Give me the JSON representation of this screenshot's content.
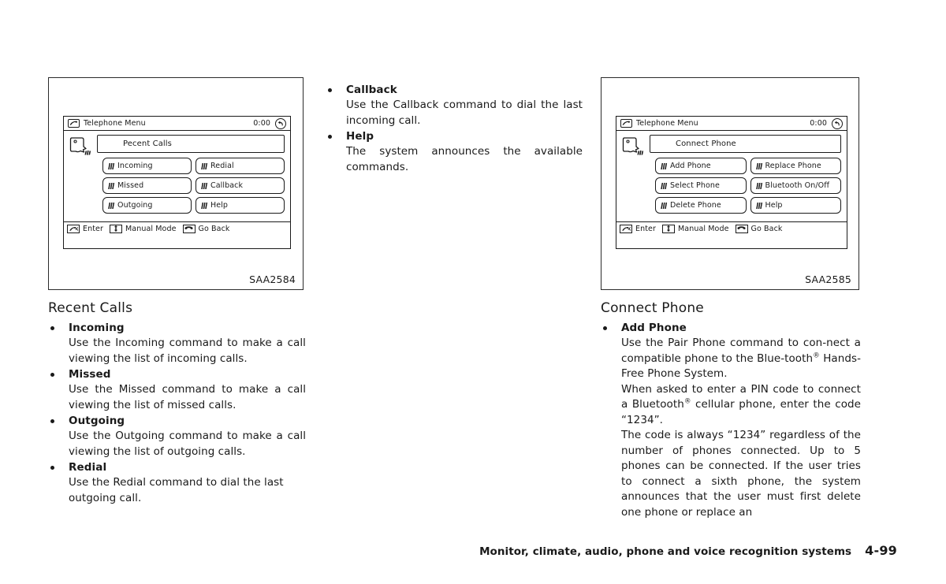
{
  "figures": [
    {
      "code": "SAA2584",
      "screen": {
        "title": "Telephone Menu",
        "clock": "0:00",
        "phone_icon": "phone-handset-icon",
        "return_icon": "return-arrow-icon",
        "head_icon": "speaking-head-icon",
        "banner_label": "Pecent Calls",
        "commands": [
          "Incoming",
          "Redial",
          "Missed",
          "Callback",
          "Outgoing",
          "Help"
        ],
        "status": [
          {
            "icon": "enter-button-icon",
            "label": "Enter"
          },
          {
            "icon": "up-down-arrows-icon",
            "label": "Manual Mode"
          },
          {
            "icon": "hang-up-phone-icon",
            "label": "Go Back"
          }
        ]
      }
    },
    {
      "code": "SAA2585",
      "screen": {
        "title": "Telephone Menu",
        "clock": "0:00",
        "phone_icon": "phone-handset-icon",
        "return_icon": "return-arrow-icon",
        "head_icon": "speaking-head-icon",
        "banner_label": "Connect Phone",
        "commands": [
          "Add Phone",
          "Replace Phone",
          "Select Phone",
          "Bluetooth On/Off",
          "Delete Phone",
          "Help"
        ],
        "status": [
          {
            "icon": "enter-button-icon",
            "label": "Enter"
          },
          {
            "icon": "up-down-arrows-icon",
            "label": "Manual Mode"
          },
          {
            "icon": "hang-up-phone-icon",
            "label": "Go Back"
          }
        ]
      }
    }
  ],
  "mid_column": {
    "items": [
      {
        "term": "Callback",
        "body": "Use the Callback command to dial the last incoming call."
      },
      {
        "term": "Help",
        "body": "The system announces the available commands."
      }
    ]
  },
  "left_section": {
    "heading": "Recent Calls",
    "items": [
      {
        "term": "Incoming",
        "body": "Use the Incoming command to make a call viewing the list of incoming calls."
      },
      {
        "term": "Missed",
        "body": "Use the Missed command to make a call viewing the list of missed calls."
      },
      {
        "term": "Outgoing",
        "body": "Use the Outgoing command to make a call viewing the list of outgoing calls."
      },
      {
        "term": "Redial",
        "body": "Use the Redial command to dial the last outgoing call."
      }
    ]
  },
  "right_section": {
    "heading": "Connect Phone",
    "term": "Add Phone",
    "paragraphs": {
      "p1_a": "Use the Pair Phone command to con-nect a compatible phone to the Blue-tooth",
      "p1_sup": "®",
      "p1_b": " Hands-Free Phone System.",
      "p2_a": "When asked to enter a PIN code to connect a Bluetooth",
      "p2_sup": "®",
      "p2_b": " cellular phone, enter the code “1234”.",
      "p3": "The code is always “1234” regardless of the number of phones connected. Up to 5 phones can be connected. If the user tries to connect a sixth phone, the system announces that the user must first delete one phone or replace an"
    }
  },
  "footer": {
    "text": "Monitor, climate, audio, phone and voice recognition systems",
    "page": "4-99"
  },
  "colors": {
    "ink": "#1a1a1a",
    "paper": "#ffffff"
  }
}
